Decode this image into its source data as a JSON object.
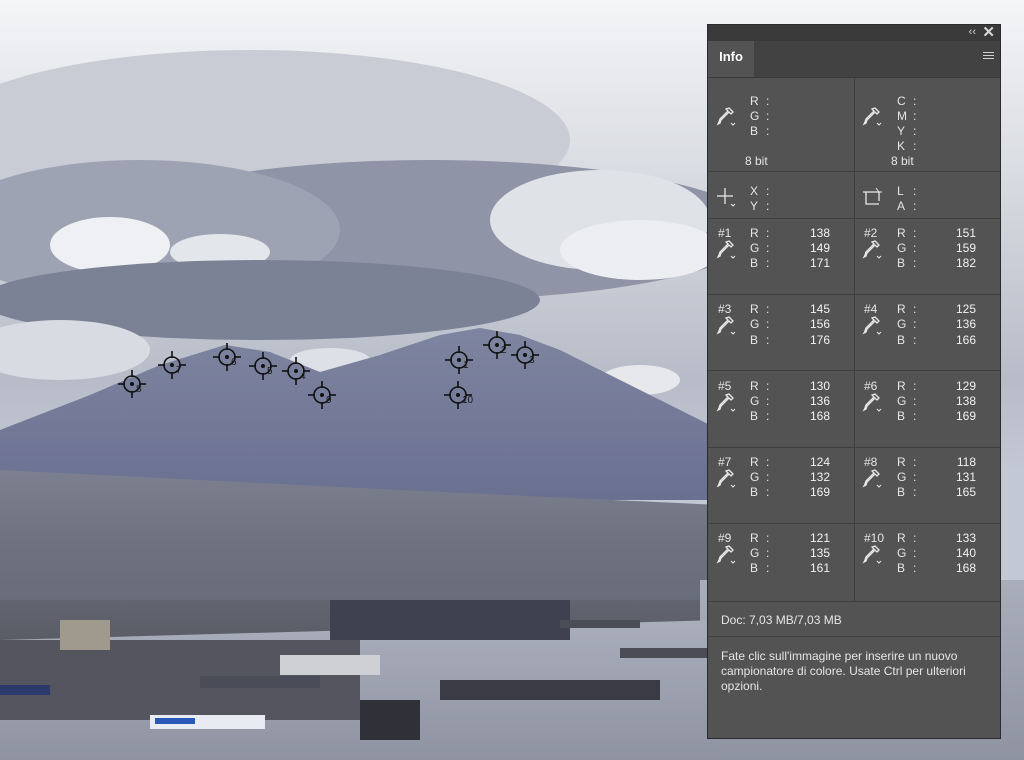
{
  "panel": {
    "tab_label": "Info",
    "collapse_glyph": "‹‹",
    "close_glyph": "✕",
    "rgb_labels": [
      "R",
      "G",
      "B"
    ],
    "cmyk_labels": [
      "C",
      "M",
      "Y",
      "K"
    ],
    "xy_labels": [
      "X",
      "Y"
    ],
    "la_labels": [
      "L",
      "A"
    ],
    "bit_depth_left": "8 bit",
    "bit_depth_right": "8 bit",
    "samplers": [
      {
        "id": "#1",
        "r": "138",
        "g": "149",
        "b": "171"
      },
      {
        "id": "#2",
        "r": "151",
        "g": "159",
        "b": "182"
      },
      {
        "id": "#3",
        "r": "145",
        "g": "156",
        "b": "176"
      },
      {
        "id": "#4",
        "r": "125",
        "g": "136",
        "b": "166"
      },
      {
        "id": "#5",
        "r": "130",
        "g": "136",
        "b": "168"
      },
      {
        "id": "#6",
        "r": "129",
        "g": "138",
        "b": "169"
      },
      {
        "id": "#7",
        "r": "124",
        "g": "132",
        "b": "169"
      },
      {
        "id": "#8",
        "r": "118",
        "g": "131",
        "b": "165"
      },
      {
        "id": "#9",
        "r": "121",
        "g": "135",
        "b": "161"
      },
      {
        "id": "#10",
        "r": "133",
        "g": "140",
        "b": "168"
      }
    ],
    "doc_text": "Doc: 7,03 MB/7,03 MB",
    "help_text": "Fate clic sull'immagine per inserire un nuovo campionatore di colore. Usate Ctrl per ulteriori opzioni."
  },
  "canvas_markers": [
    "1",
    "2",
    "3",
    "4",
    "5",
    "6",
    "7",
    "8",
    "9",
    "10"
  ],
  "icons": {
    "eyedropper": "eyedropper-icon",
    "crosshair": "crosshair-icon",
    "selection": "selection-size-icon",
    "menu": "panel-menu-icon",
    "sampler": "color-sampler-icon"
  },
  "colors": {
    "panel_bg": "#535353",
    "panel_header": "#3a3a3a",
    "tab_bar": "#424242",
    "text": "#e6e6e6"
  }
}
